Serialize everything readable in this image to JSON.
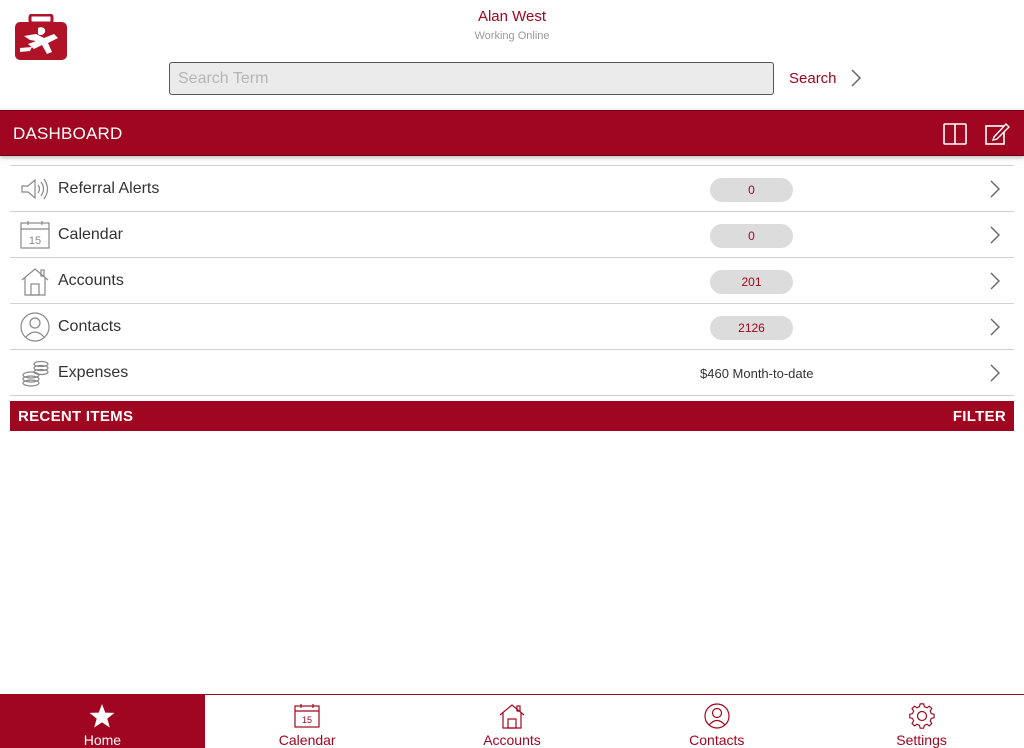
{
  "header": {
    "user_name": "Alan West",
    "status": "Working Online",
    "search_placeholder": "Search Term",
    "search_value": "",
    "search_label": "Search"
  },
  "dashboard": {
    "title": "DASHBOARD",
    "icons": [
      "split-view-icon",
      "compose-icon"
    ]
  },
  "rows": [
    {
      "label": "Referral Alerts",
      "badge": "0",
      "icon": "megaphone-icon"
    },
    {
      "label": "Calendar",
      "badge": "0",
      "icon": "calendar-icon"
    },
    {
      "label": "Accounts",
      "badge": "201",
      "icon": "house-icon"
    },
    {
      "label": "Contacts",
      "badge": "2126",
      "icon": "person-icon"
    },
    {
      "label": "Expenses",
      "value": "$460 Month-to-date",
      "icon": "coins-icon"
    }
  ],
  "recent": {
    "title": "RECENT ITEMS",
    "filter_label": "FILTER"
  },
  "tabs": [
    {
      "label": "Home",
      "icon": "star-icon",
      "active": true
    },
    {
      "label": "Calendar",
      "icon": "calendar-icon"
    },
    {
      "label": "Accounts",
      "icon": "house-icon"
    },
    {
      "label": "Contacts",
      "icon": "person-icon"
    },
    {
      "label": "Settings",
      "icon": "gear-icon"
    }
  ],
  "colors": {
    "brand": "#a0061f",
    "badge_bg": "#dcdcdc",
    "divider": "#d2d2d2"
  }
}
